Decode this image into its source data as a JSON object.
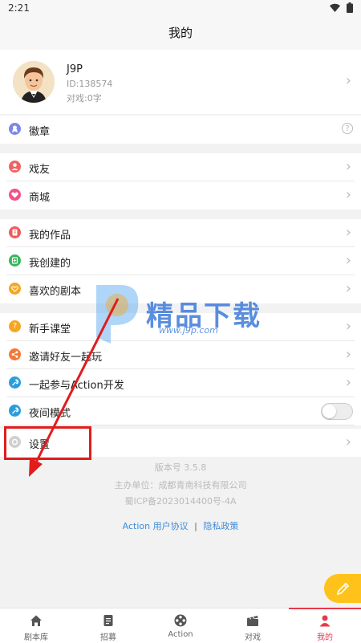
{
  "status_bar": {
    "time": "2:21"
  },
  "header": {
    "title": "我的"
  },
  "profile": {
    "name": "J9P",
    "id": "ID:138574",
    "words": "对戏:0字"
  },
  "menu": [
    {
      "label": "徽章",
      "icon": "badge-icon",
      "color": "#7b87e8"
    },
    {
      "label": "戏友",
      "icon": "friend-icon",
      "color": "#f06262"
    },
    {
      "label": "商城",
      "icon": "shop-icon",
      "color": "#f0528a"
    },
    {
      "label": "我的作品",
      "icon": "works-icon",
      "color": "#f05a5a"
    },
    {
      "label": "我创建的",
      "icon": "created-icon",
      "color": "#36b85a"
    },
    {
      "label": "喜欢的剧本",
      "icon": "heart-icon",
      "color": "#f5a623"
    },
    {
      "label": "新手课堂",
      "icon": "question-icon",
      "color": "#f5a623"
    },
    {
      "label": "邀请好友一起玩",
      "icon": "share-icon",
      "color": "#f07a3a"
    },
    {
      "label": "一起参与Action开发",
      "icon": "wrench-icon",
      "color": "#2d9cdb"
    },
    {
      "label": "夜间模式",
      "icon": "moon-icon",
      "color": "#2d9cdb"
    },
    {
      "label": "设置",
      "icon": "settings-icon",
      "color": "#c8c8c8"
    }
  ],
  "night_mode": {
    "enabled": false
  },
  "footer": {
    "version": "版本号 3.5.8",
    "organizer": "主办单位：成都青南科技有限公司",
    "icp": "蜀ICP备2023014400号-4A",
    "user_agreement": "Action 用户协议",
    "divider": "|",
    "privacy": "隐私政策"
  },
  "watermark": {
    "text": "精品下载",
    "url": "www.j9p.com"
  },
  "tabs": [
    {
      "label": "剧本库",
      "icon": "home-icon",
      "active": false
    },
    {
      "label": "招募",
      "icon": "document-icon",
      "active": false
    },
    {
      "label": "Action",
      "icon": "film-reel-icon",
      "active": false
    },
    {
      "label": "对戏",
      "icon": "clapperboard-icon",
      "active": false
    },
    {
      "label": "我的",
      "icon": "person-icon",
      "active": true
    }
  ],
  "colors": {
    "accent": "#e8394a",
    "fab": "#ffc21a",
    "annotation": "#e01d1d",
    "link": "#3e8cd8"
  }
}
